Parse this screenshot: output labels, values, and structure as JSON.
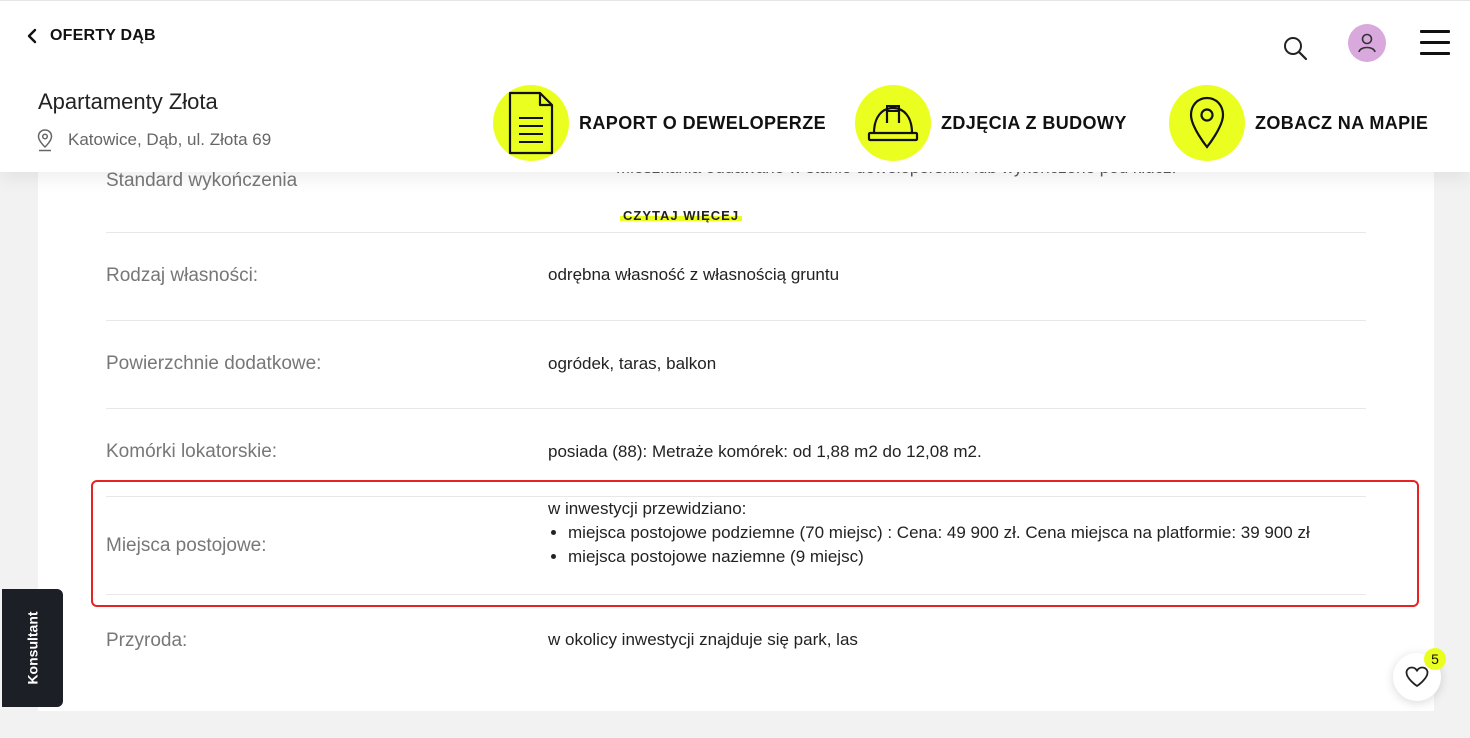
{
  "header": {
    "back_label": "OFERTY DĄB",
    "title": "Apartamenty Złota",
    "address": "Katowice, Dąb, ul. Złota 69",
    "actions": [
      {
        "label": "RAPORT O DEWELOPERZE",
        "icon": "document-icon"
      },
      {
        "label": "ZDJĘCIA Z BUDOWY",
        "icon": "hard-hat-icon"
      },
      {
        "label": "ZOBACZ NA MAPIE",
        "icon": "map-pin-icon"
      }
    ],
    "icons": {
      "search": "search-icon",
      "avatar": "user-icon",
      "menu": "hamburger-icon"
    }
  },
  "details": {
    "standard": {
      "label": "Standard wykończenia",
      "value_cut": "Mieszkania oddawane w stanie deweloperskim lub wykończone pod klucz.",
      "read_more": "CZYTAJ WIĘCEJ"
    },
    "ownership": {
      "label": "Rodzaj własności:",
      "value": "odrębna własność z własnością gruntu"
    },
    "extra_areas": {
      "label": "Powierzchnie dodatkowe:",
      "value": "ogródek, taras, balkon"
    },
    "storage": {
      "label": "Komórki lokatorskie:",
      "value": "posiada (88): Metraże komórek: od 1,88 m2 do 12,08 m2."
    },
    "parking": {
      "label": "Miejsca postojowe:",
      "intro": "w inwestycji przewidziano:",
      "items": [
        "miejsca postojowe podziemne (70 miejsc) : Cena: 49 900 zł. Cena miejsca na platformie: 39 900 zł",
        "miejsca postojowe naziemne (9 miejsc)"
      ]
    },
    "nature": {
      "label": "Przyroda:",
      "value": "w okolicy inwestycji znajduje się park, las"
    }
  },
  "consultant_tab": "Konsultant",
  "favorites": {
    "count": "5"
  },
  "colors": {
    "accent": "#eaff1f",
    "avatar": "#d9a8dc",
    "highlight": "#e62222",
    "consultant_bg": "#1c1f26"
  }
}
